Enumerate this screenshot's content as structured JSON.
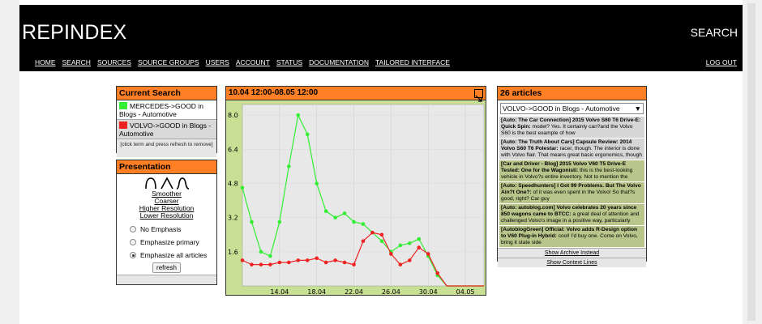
{
  "header": {
    "brand": "REPINDEX",
    "search": "SEARCH",
    "nav": [
      "HOME",
      "SEARCH",
      "SOURCES",
      "SOURCE GROUPS",
      "USERS",
      "ACCOUNT",
      "STATUS",
      "DOCUMENTATION",
      "TAILORED INTERFACE"
    ],
    "logout": "LOG OUT"
  },
  "current_search": {
    "title": "Current Search",
    "terms": [
      {
        "label": "MERCEDES->GOOD in Blogs - Automotive",
        "color": "#33ee33"
      },
      {
        "label": "VOLVO->GOOD in Blogs - Automotive",
        "color": "#ee2222"
      }
    ],
    "hint": "[click term and press refresh to remove]"
  },
  "presentation": {
    "title": "Presentation",
    "links": [
      "Smoother",
      "Coarser",
      "Higher Resolution",
      "Lower Resolution"
    ],
    "options": [
      "No Emphasis",
      "Emphasize primary",
      "Emphasize all articles"
    ],
    "selected_option": "Emphasize all articles",
    "refresh": "refresh"
  },
  "chart_panel": {
    "title": "10.04 12:00-08.05 12:00"
  },
  "chart_data": {
    "type": "line",
    "x": [
      "10.04",
      "11.04",
      "12.04",
      "13.04",
      "14.04",
      "15.04",
      "16.04",
      "17.04",
      "18.04",
      "19.04",
      "20.04",
      "21.04",
      "22.04",
      "23.04",
      "24.04",
      "25.04",
      "26.04",
      "27.04",
      "28.04",
      "29.04",
      "30.04",
      "01.05",
      "02.05",
      "03.05",
      "04.05",
      "05.05",
      "06.05"
    ],
    "x_ticks": [
      "14.04",
      "18.04",
      "22.04",
      "26.04",
      "30.04",
      "04.05"
    ],
    "ylim": [
      0,
      8.5
    ],
    "y_ticks": [
      "1.6",
      "3.2",
      "4.8",
      "6.4",
      "8.0"
    ],
    "series": [
      {
        "color": "#33ee33",
        "values": [
          4.6,
          3.0,
          1.6,
          1.4,
          3.0,
          5.6,
          8.0,
          7.1,
          4.8,
          3.5,
          3.2,
          3.4,
          3.0,
          2.9,
          2.5,
          2.1,
          1.6,
          1.9,
          2.0,
          2.2,
          1.4,
          0.5,
          0.0,
          0.0,
          0.0,
          0.0,
          0.0
        ]
      },
      {
        "color": "#ee2222",
        "values": [
          1.2,
          1.0,
          1.0,
          1.0,
          1.1,
          1.1,
          1.2,
          1.2,
          1.3,
          1.1,
          1.2,
          1.1,
          1.0,
          2.1,
          2.5,
          2.4,
          1.5,
          1.0,
          1.2,
          1.8,
          1.5,
          0.6,
          0.0,
          0.0,
          0.0,
          0.0,
          0.0
        ]
      }
    ]
  },
  "articles_panel": {
    "title": "26 articles",
    "selected_term": "VOLVO->GOOD in Blogs - Automotive",
    "articles": [
      {
        "head": "[Auto: The Car Connection] 2015 Volvo S60 T6 Drive-E: Quick Spin:",
        "body": " model? Yes. It certainly can?and the Volvo S60 is the best example of how",
        "shade": "g"
      },
      {
        "head": "[Auto: The Truth About Cars] Capsule Review: 2014 Volvo S60 T6 Polestar:",
        "body": " racer, though. The interior is done with Volvo flair. That means great basic ergonomics, though",
        "shade": "g"
      },
      {
        "head": "[Car and Driver - Blog] 2015 Volvo V60 T5 Drive-E Tested: One for the Wagonisti:",
        "body": " this is the best-looking vehicle in Volvo?s entire inventory. Not to mention the",
        "shade": "o"
      },
      {
        "head": "[Auto: Speedhunters] I Got 99 Problems. But The Volvo Ain?t One?:",
        "body": " of it was even spent in the Volvo! So that?s good, right? Car guy",
        "shade": "o"
      },
      {
        "head": "[Auto: autoblog.com] Volvo celebrates 20 years since 850 wagons came to BTCC:",
        "body": " a great deal of attention and challenged Volvo's image in a positive way, particularly",
        "shade": "o"
      },
      {
        "head": "[AutoblogGreen] Official: Volvo adds R-Design option to V60 Plug-in Hybrid:",
        "body": " cool! I'd buy one. Come on Volvo, bring it state side",
        "shade": "o"
      }
    ],
    "show_archive": "Show Archive Instead",
    "show_context": "Show Context Lines"
  }
}
